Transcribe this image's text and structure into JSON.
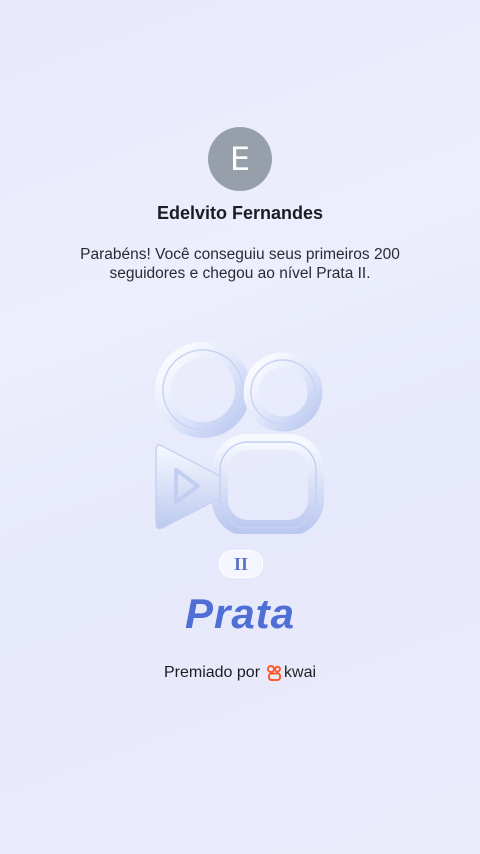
{
  "profile": {
    "avatar_letter": "E",
    "name": "Edelvito Fernandes"
  },
  "message": "Parabéns! Você conseguiu seus primeiros 200 seguidores e chegou ao nível Prata II.",
  "badge": {
    "tier": "II",
    "level": "Prata"
  },
  "award": {
    "prefix": "Premiado por",
    "brand": "kwai"
  },
  "colors": {
    "accent": "#4f6fd6",
    "brand": "#ff5a2d"
  }
}
